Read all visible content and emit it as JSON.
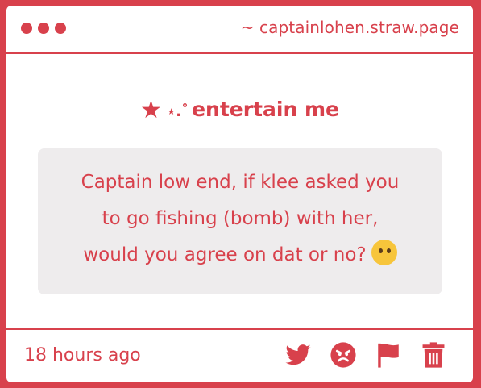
{
  "window": {
    "dots": 3,
    "url": "~ captainlohen.straw.page"
  },
  "card": {
    "heading_text": "entertain me",
    "heading_star": "★",
    "heading_sparkle": "⋆.˚",
    "question": "Captain low end, if klee asked you to go fishing (bomb) with her, would you agree on dat or no?",
    "question_lines": [
      "Captain low end, if klee asked you",
      "to go fishing (bomb) with her,",
      "would you agree on dat or no?"
    ],
    "question_emoji": "thinking-face-emoji"
  },
  "footer": {
    "timestamp": "18 hours ago",
    "actions": [
      "twitter-icon",
      "angry-face-icon",
      "flag-icon",
      "trash-icon"
    ]
  },
  "colors": {
    "accent": "#d8414c",
    "bubble": "#eeeced",
    "background": "#ffffff"
  }
}
